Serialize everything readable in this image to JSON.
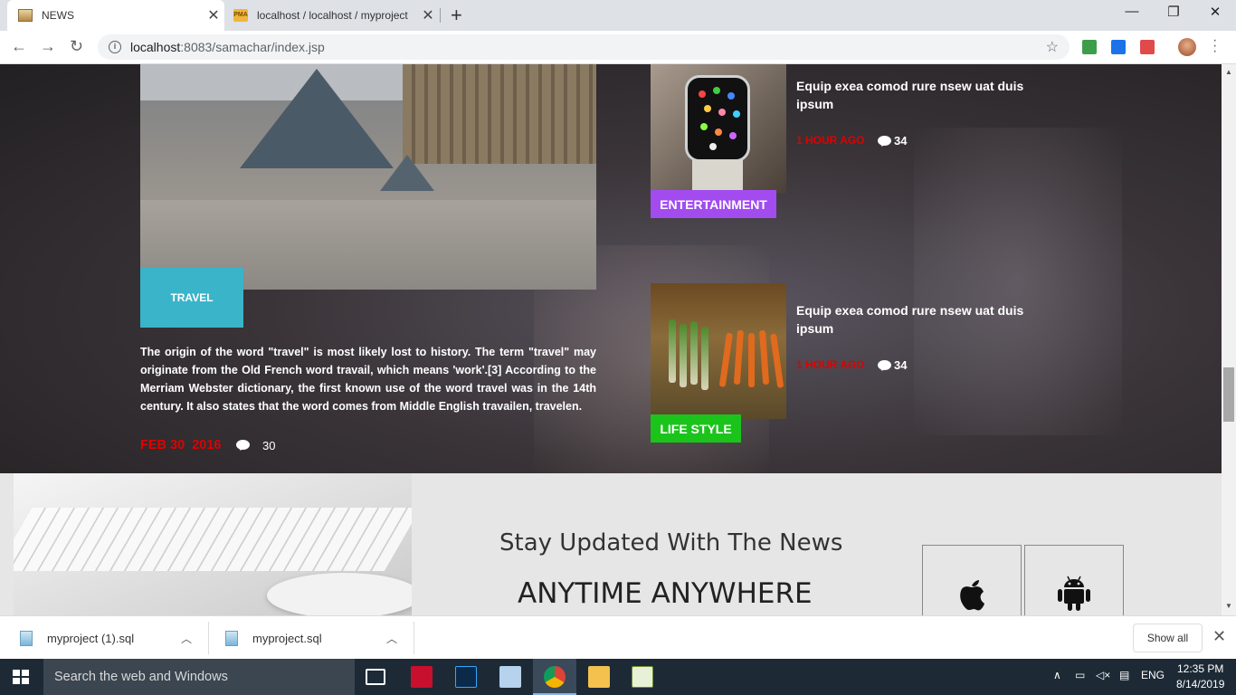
{
  "browser": {
    "tabs": [
      {
        "title": "NEWS",
        "active": true
      },
      {
        "title": "localhost / localhost / myproject",
        "active": false
      }
    ],
    "url_host": "localhost",
    "url_rest": ":8083/samachar/index.jsp",
    "favicon2_text": "PMA"
  },
  "featured": {
    "category": "TRAVEL",
    "category_color": "#3ab4c9",
    "text": "The origin of the word \"travel\" is most likely lost to history. The term \"travel\" may originate from the Old French word travail, which means 'work'.[3] According to the Merriam Webster dictionary, the first known use of the word travel was in the 14th century. It also states that the word comes from Middle English travailen, travelen.",
    "date": "FEB 30  2016",
    "comments": "30"
  },
  "side_stories": [
    {
      "title": " Equip exea comod rure  nsew uat duis ipsum",
      "ago": "1 HOUR AGO",
      "comments": "34",
      "category": "ENTERTAINMENT",
      "category_color": "#a24cf0"
    },
    {
      "title": " Equip exea comod rure  nsew uat duis ipsum",
      "ago": "1 HOUR AGO",
      "comments": "34",
      "category": "LIFE STYLE",
      "category_color": "#1bc41b"
    }
  ],
  "newsletter": {
    "heading": "Stay Updated With The News",
    "subheading": "ANYTIME ANYWHERE",
    "apps": [
      "apple-icon",
      "android-icon"
    ]
  },
  "downloads": {
    "items": [
      "myproject (1).sql",
      "myproject.sql"
    ],
    "show_all": "Show all"
  },
  "taskbar": {
    "search_placeholder": "Search the web and Windows",
    "lang": "ENG",
    "time": "12:35 PM",
    "date": "8/14/2019"
  }
}
